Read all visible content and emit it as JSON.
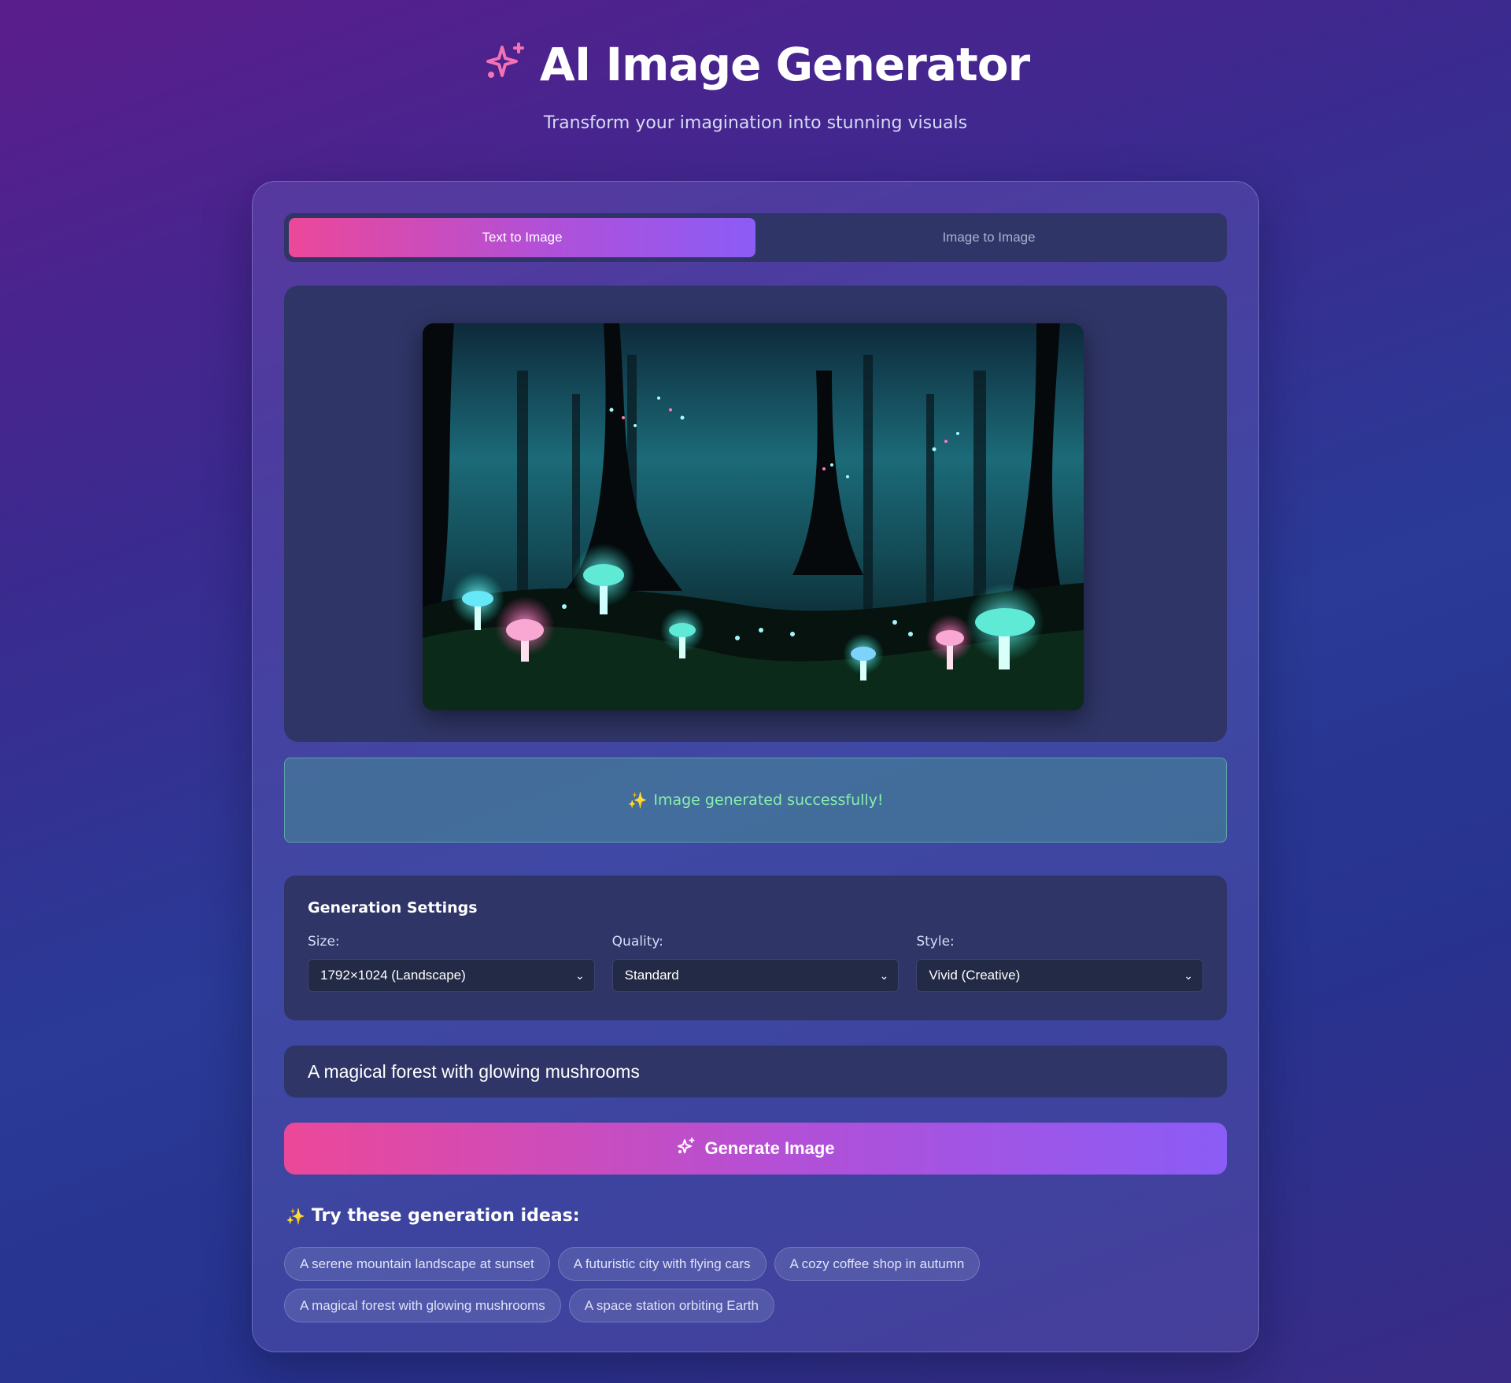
{
  "header": {
    "title": "AI Image Generator",
    "subtitle": "Transform your imagination into stunning visuals",
    "icon": "sparkles-icon",
    "icon_color": "#f472b6"
  },
  "tabs": [
    {
      "label": "Text to Image",
      "active": true
    },
    {
      "label": "Image to Image",
      "active": false
    }
  ],
  "preview": {
    "alt": "A magical forest with glowing mushrooms"
  },
  "status": {
    "icon": "✨",
    "message": "Image generated successfully!",
    "color": "#86efac"
  },
  "settings": {
    "title": "Generation Settings",
    "size": {
      "label": "Size:",
      "value": "1792×1024 (Landscape)"
    },
    "quality": {
      "label": "Quality:",
      "value": "Standard"
    },
    "style": {
      "label": "Style:",
      "value": "Vivid (Creative)"
    }
  },
  "prompt": {
    "value": "A magical forest with glowing mushrooms"
  },
  "generate_button": {
    "label": "Generate Image"
  },
  "ideas": {
    "icon": "✨",
    "title": "Try these generation ideas:",
    "items": [
      "A serene mountain landscape at sunset",
      "A futuristic city with flying cars",
      "A cozy coffee shop in autumn",
      "A magical forest with glowing mushrooms",
      "A space station orbiting Earth"
    ]
  },
  "colors": {
    "accent_start": "#ec4899",
    "accent_end": "#8b5cf6",
    "panel": "#2f3566"
  }
}
